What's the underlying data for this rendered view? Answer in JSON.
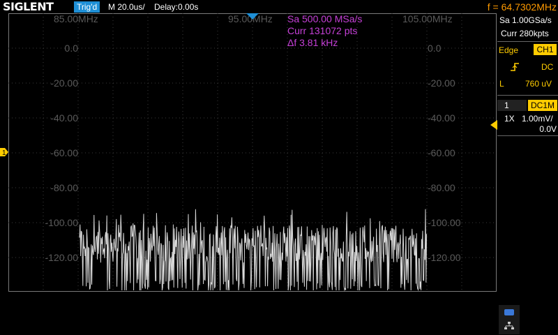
{
  "header": {
    "logo": "SIGLENT",
    "trigger_status": "Trig'd",
    "timebase": "M 20.0us/",
    "delay": "Delay:0.00s",
    "frequency": "f = 64.7302MHz"
  },
  "fft": {
    "x_labels": [
      "85.00MHz",
      "95.00MHz",
      "105.00MHz"
    ],
    "y_labels": [
      "0.0",
      "-20.00",
      "-40.00",
      "-60.00",
      "-80.00",
      "-100.00",
      "-120.00"
    ],
    "info": {
      "sample_rate": "Sa 500.00 MSa/s",
      "points": "Curr 131072 pts",
      "resolution": "Δf 3.81 kHz"
    },
    "noise_floor_db": -112,
    "noise_span_db": [
      -140,
      -90
    ]
  },
  "right_panel": {
    "acq_rate": "Sa 1.00GSa/s",
    "memory": "Curr 280kpts",
    "trigger": {
      "type": "Edge",
      "source": "CH1",
      "slope_icon": "rising-edge-icon",
      "coupling": "DC",
      "level_label": "L",
      "level": "760 uV"
    },
    "channel": {
      "number": "1",
      "coupling": "DC1M",
      "probe": "1X",
      "scale": "1.00mV/",
      "offset": "0.0V"
    }
  },
  "markers": {
    "ch1": "1"
  },
  "colors": {
    "trigger_yellow": "#ffcc00",
    "fft_magenta": "#c640d8",
    "frequency_orange": "#ff9a00",
    "trig_status_blue": "#1e8fd6",
    "trace_white": "#d8d8d8"
  }
}
